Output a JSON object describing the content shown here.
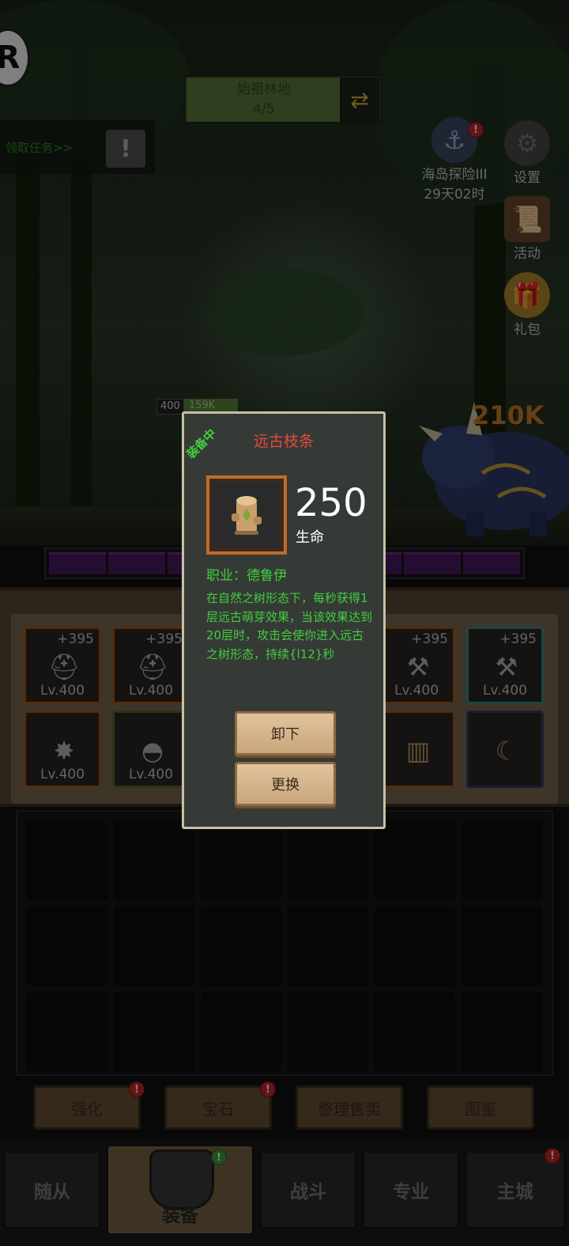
{
  "hud": {
    "location_name": "始祖林地",
    "location_progress": "4/5",
    "quest_text": "领取任务>>",
    "event_label": "海岛探险III",
    "event_timer": "29天02时",
    "settings_label": "设置",
    "activity_label": "活动",
    "gift_label": "礼包",
    "monster_damage": "210K",
    "player_level": "400",
    "player_hp": "159K",
    "logo_letter": "R"
  },
  "equipment": {
    "slots_row1": [
      {
        "plus": "+395",
        "level": "Lv.400",
        "icon": "helmet-icon"
      },
      {
        "plus": "+395",
        "level": "Lv.400",
        "icon": "cap-icon"
      },
      {
        "plus": "+395",
        "level": "Lv.400",
        "icon": "axe-icon"
      },
      {
        "plus": "+395",
        "level": "Lv.400",
        "icon": "hammer-icon"
      }
    ],
    "slots_row2": [
      {
        "level": "Lv.400",
        "icon": "armor-icon"
      },
      {
        "level": "Lv.400",
        "icon": "shoulder-icon"
      }
    ]
  },
  "actions": {
    "enhance": "强化",
    "gem": "宝石",
    "sort_sell": "整理售卖",
    "codex": "图鉴"
  },
  "nav": {
    "followers": "随从",
    "equipment": "装备",
    "battle": "战斗",
    "profession": "专业",
    "main_city": "主城"
  },
  "popup": {
    "equipped_tag": "装备中",
    "title": "远古枝条",
    "stat_value": "250",
    "stat_name": "生命",
    "class_line": "职业：德鲁伊",
    "description": "在自然之树形态下，每秒获得1层远古萌芽效果，当该效果达到20层时，攻击会使你进入远古之树形态，持续{l12}秒",
    "unequip_button": "卸下",
    "replace_button": "更换",
    "item_icon": "wooden-branch-icon"
  },
  "colors": {
    "title_red": "#e54a3a",
    "desc_green": "#3fcf3f",
    "frame_orange": "#c46a2a"
  }
}
